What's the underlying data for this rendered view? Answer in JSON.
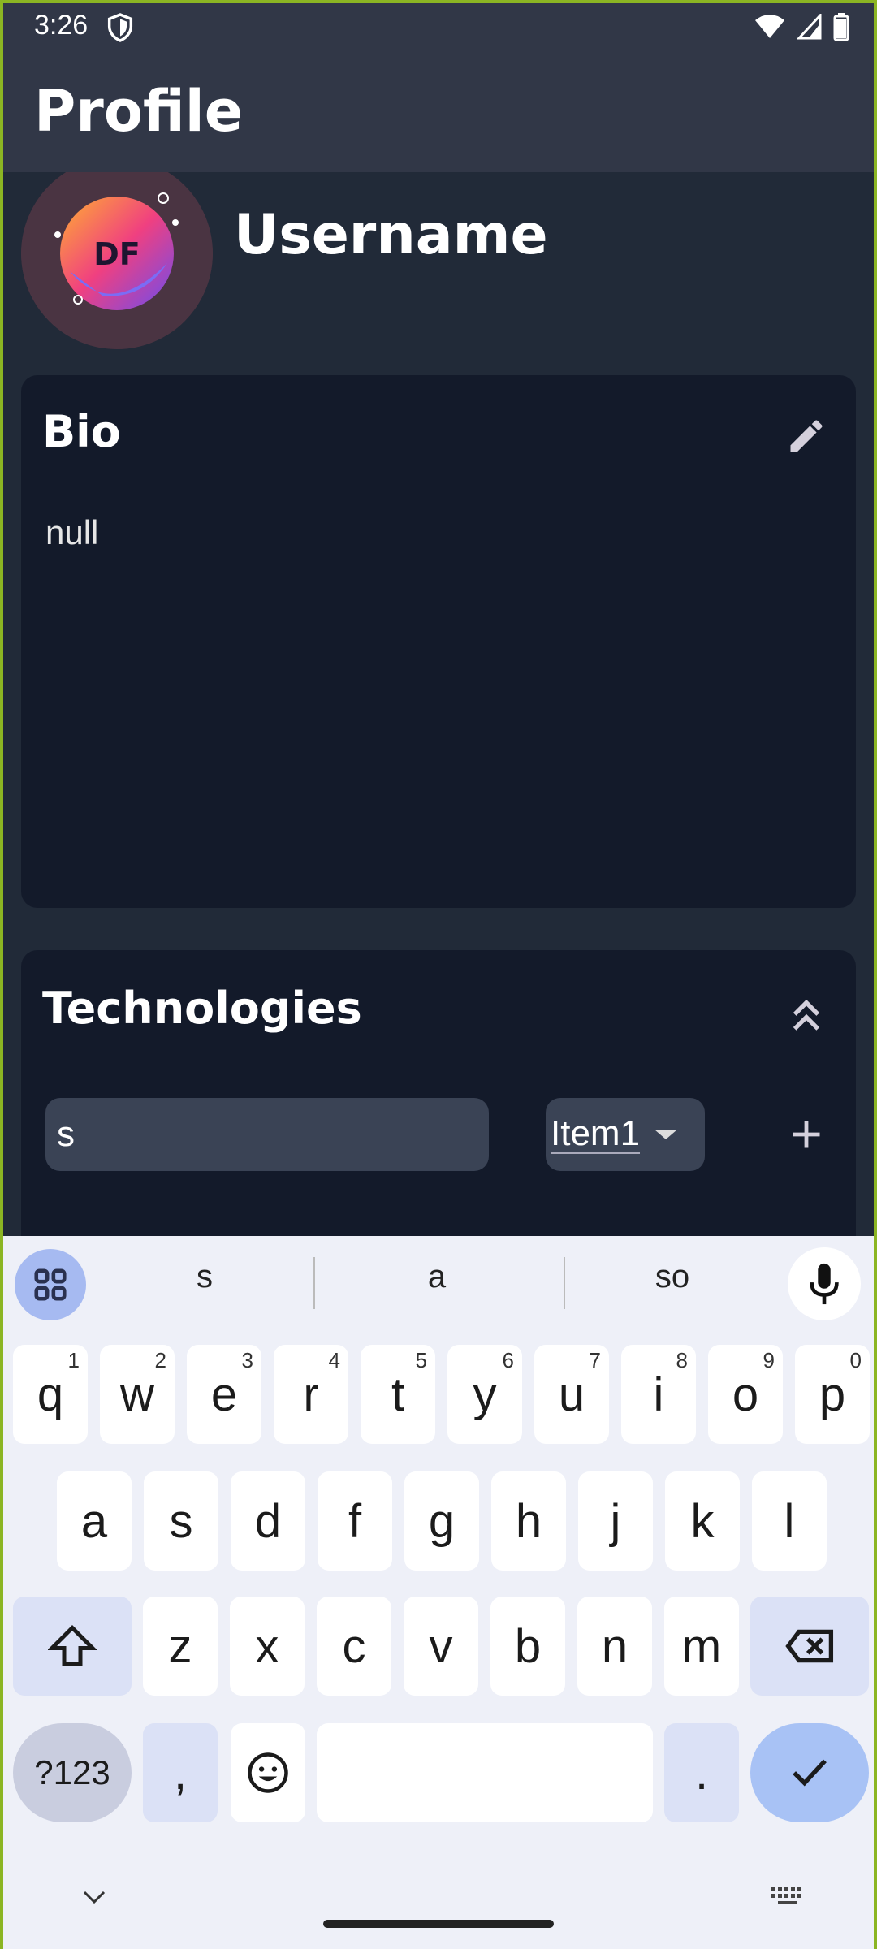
{
  "status_bar": {
    "time": "3:26"
  },
  "app_bar": {
    "title": "Profile"
  },
  "profile": {
    "username": "Username",
    "avatar_text": "DF"
  },
  "bio": {
    "header": "Bio",
    "text": "null"
  },
  "technologies": {
    "header": "Technologies",
    "input_value": "s",
    "dropdown_selected": "Item1"
  },
  "keyboard": {
    "suggestions": [
      "s",
      "a",
      "so"
    ],
    "row1": [
      {
        "k": "q",
        "s": "1"
      },
      {
        "k": "w",
        "s": "2"
      },
      {
        "k": "e",
        "s": "3"
      },
      {
        "k": "r",
        "s": "4"
      },
      {
        "k": "t",
        "s": "5"
      },
      {
        "k": "y",
        "s": "6"
      },
      {
        "k": "u",
        "s": "7"
      },
      {
        "k": "i",
        "s": "8"
      },
      {
        "k": "o",
        "s": "9"
      },
      {
        "k": "p",
        "s": "0"
      }
    ],
    "row2": [
      "a",
      "s",
      "d",
      "f",
      "g",
      "h",
      "j",
      "k",
      "l"
    ],
    "row3": [
      "z",
      "x",
      "c",
      "v",
      "b",
      "n",
      "m"
    ],
    "symbols_label": "?123",
    "comma": ",",
    "period": "."
  },
  "colors": {
    "accent_border": "#8bb523",
    "app_bar": "#313747",
    "card": "#131a2a",
    "keyboard_enter": "#a8c2f5"
  },
  "icons": {
    "edit": "pencil-icon",
    "collapse": "double-chevron-up-icon",
    "add": "plus-icon",
    "mic": "mic-icon",
    "grid": "apps-grid-icon"
  }
}
